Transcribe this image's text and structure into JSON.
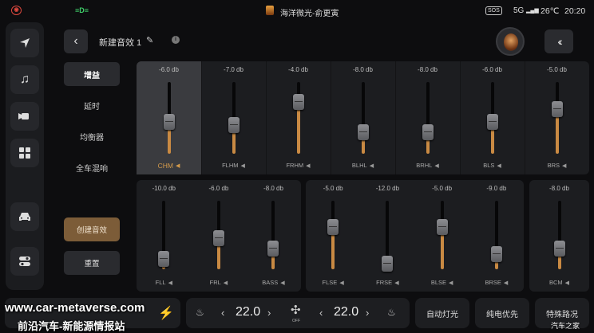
{
  "status": {
    "now_playing": "海洋微光-俞更寅",
    "sos": "SOS",
    "network": "5G",
    "temperature": "26℃",
    "time": "20:20"
  },
  "header": {
    "back_icon": "chevron-left-icon",
    "title": "新建音效 1",
    "collapse_icon": "double-chevron-left-icon"
  },
  "menu": {
    "items": [
      "增益",
      "延时",
      "均衡器",
      "全车混响"
    ]
  },
  "actions": {
    "create": "创建音效",
    "reset": "重置"
  },
  "channels_top": [
    {
      "db": "-6.0 db",
      "label": "CHM",
      "level": 0.45,
      "selected": true
    },
    {
      "db": "-7.0 db",
      "label": "FLHM",
      "level": 0.4
    },
    {
      "db": "-4.0 db",
      "label": "FRHM",
      "level": 0.72
    },
    {
      "db": "-8.0 db",
      "label": "BLHL",
      "level": 0.3
    },
    {
      "db": "-8.0 db",
      "label": "BRHL",
      "level": 0.3
    },
    {
      "db": "-6.0 db",
      "label": "BLS",
      "level": 0.45
    },
    {
      "db": "-5.0 db",
      "label": "BRS",
      "level": 0.62
    }
  ],
  "channels_left": [
    {
      "db": "-10.0 db",
      "label": "FLL",
      "level": 0.15
    },
    {
      "db": "-6.0 db",
      "label": "FRL",
      "level": 0.45
    },
    {
      "db": "-8.0 db",
      "label": "BASS",
      "level": 0.3
    }
  ],
  "channels_mid": [
    {
      "db": "-5.0 db",
      "label": "FLSE",
      "level": 0.62
    },
    {
      "db": "-12.0 db",
      "label": "FRSE",
      "level": 0.08
    },
    {
      "db": "-5.0 db",
      "label": "BLSE",
      "level": 0.62
    },
    {
      "db": "-9.0 db",
      "label": "BRSE",
      "level": 0.22
    }
  ],
  "channels_right": [
    {
      "db": "-8.0 db",
      "label": "BCM",
      "level": 0.3
    }
  ],
  "climate": {
    "temp_left": "22.0",
    "temp_right": "22.0",
    "fan_label": "OFF"
  },
  "quick": {
    "auto_light": "自动灯光",
    "ev_priority": "纯电优先",
    "special_road": "特殊路况"
  },
  "watermark": {
    "url": "www.car-metaverse.com",
    "tagline": "前沿汽车-新能源情报站",
    "corner": "汽车之家"
  }
}
